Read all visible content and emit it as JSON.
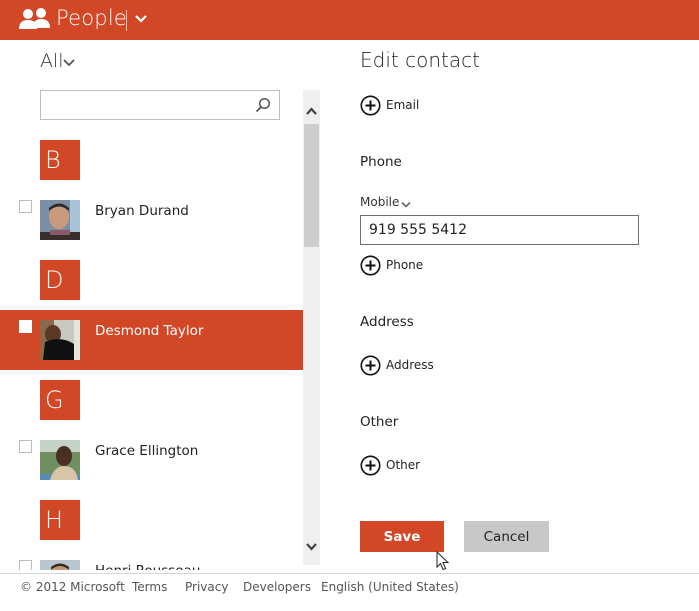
{
  "app": {
    "title": "People",
    "brand_color": "#d24726"
  },
  "list": {
    "filter_label": "All",
    "search_placeholder": "",
    "search_value": "",
    "groups": [
      {
        "letter": "B",
        "contacts": [
          {
            "name": "Bryan Durand",
            "selected": false,
            "checked": false
          }
        ]
      },
      {
        "letter": "D",
        "contacts": [
          {
            "name": "Desmond Taylor",
            "selected": true,
            "checked": false
          }
        ]
      },
      {
        "letter": "G",
        "contacts": [
          {
            "name": "Grace Ellington",
            "selected": false,
            "checked": false
          }
        ]
      },
      {
        "letter": "H",
        "contacts": [
          {
            "name": "Henri Rousseau",
            "selected": false,
            "checked": false
          }
        ]
      }
    ]
  },
  "editor": {
    "title": "Edit contact",
    "add_email_label": "Email",
    "phone_section": "Phone",
    "phone_type_label": "Mobile",
    "phone_value": "919 555 5412",
    "add_phone_label": "Phone",
    "address_section": "Address",
    "add_address_label": "Address",
    "other_section": "Other",
    "add_other_label": "Other",
    "save_label": "Save",
    "cancel_label": "Cancel"
  },
  "footer": {
    "copyright": "© 2012 Microsoft",
    "links": [
      "Terms",
      "Privacy",
      "Developers",
      "English (United States)"
    ]
  }
}
